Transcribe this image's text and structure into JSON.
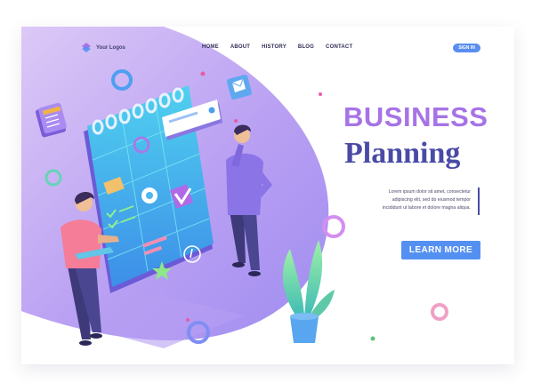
{
  "header": {
    "logo_text": "Your Logos",
    "nav": [
      "HOME",
      "ABOUT",
      "HISTORY",
      "BLOG",
      "CONTACT"
    ],
    "sign_in": "SIGN IN"
  },
  "hero": {
    "title_line1": "BUSINESS",
    "title_line2": "Planning",
    "description_lines": [
      "Lorem ipsum dolor sit amet, consectetur",
      "adipiscing elit, sed do eiusmod tempor",
      "incididunt ut labore et dolore magna aliqua."
    ],
    "cta_label": "LEARN MORE"
  },
  "colors": {
    "accent_purple": "#a773e6",
    "title_navy": "#4a4aa6",
    "button_blue": "#5490f2",
    "hero_gradient_start": "#d8c3f4",
    "hero_gradient_end": "#9d86f0"
  },
  "illustration": {
    "icons": [
      "calendar-app-icon",
      "gear-icon",
      "check-list-icon",
      "star-icon",
      "compass-icon",
      "checkmark-badge-icon",
      "mail-icon",
      "calendar-widget-icon"
    ]
  }
}
